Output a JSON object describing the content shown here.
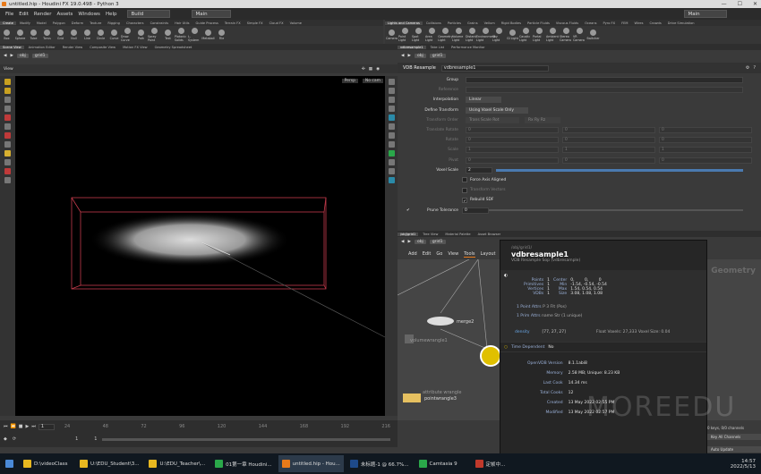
{
  "window": {
    "title": "untitled.hip - Houdini FX 19.0.498 - Python 3"
  },
  "menubar": {
    "items": [
      "File",
      "Edit",
      "Render",
      "Assets",
      "Windows",
      "Help"
    ],
    "build": "Build",
    "desktop": "Main",
    "desktop2": "Main"
  },
  "shelf_left": {
    "tabs": [
      "Create",
      "Modify",
      "Model",
      "Polygon",
      "Deform",
      "Texture",
      "Rigging",
      "Characters",
      "Constraints",
      "Hair Utils",
      "Guide Process",
      "Terrain FX",
      "Simple FX",
      "Cloud FX",
      "Volume"
    ],
    "tools": [
      "Box",
      "Sphere",
      "Tube",
      "Torus",
      "Grid",
      "Null",
      "Line",
      "Circle",
      "Curve",
      "Draw Curve",
      "Path",
      "Spray Paint",
      "Text",
      "Platonic Solids",
      "L-System",
      "Metaball",
      "File"
    ]
  },
  "shelf_right": {
    "tabs": [
      "Lights and Cameras",
      "Collisions",
      "Particles",
      "Grains",
      "Vellum",
      "Rigid Bodies",
      "Particle Fluids",
      "Viscous Fluids",
      "Oceans",
      "Pyro FX",
      "FEM",
      "Wires",
      "Crowds",
      "Drive Simulation"
    ],
    "tools": [
      "Camera",
      "Point Light",
      "Spot Light",
      "Area Light",
      "Geometry Light",
      "Volume Light",
      "Distant Light",
      "Environment Light",
      "Sky Light",
      "GI Light",
      "Caustic Light",
      "Portal Light",
      "Ambient Light",
      "Stereo Camera",
      "VR Camera",
      "Switcher"
    ]
  },
  "left_pane": {
    "tabs": [
      "Scene View",
      "Animation Editor",
      "Render View",
      "Composite View",
      "Motion FX View",
      "Geometry Spreadsheet"
    ],
    "viewer_label": "View",
    "path": [
      "obj",
      "grid1"
    ],
    "persp": "Persp",
    "cam": "No cam"
  },
  "right_pane": {
    "tabs": [
      "vdbresample1",
      "Take List",
      "Performance Monitor"
    ],
    "path": [
      "obj",
      "grid1"
    ]
  },
  "parameters": {
    "node_type": "VDB Resample",
    "node_name": "vdbresample1",
    "rows": [
      {
        "label": "Group",
        "value": "",
        "dim": false
      },
      {
        "label": "Reference",
        "value": "",
        "dim": true
      },
      {
        "label": "Interpolation",
        "value": "Linear",
        "dim": false
      },
      {
        "label": "Define Transform",
        "value": "Using Voxel Scale Only",
        "dim": false
      },
      {
        "label": "Transform Order",
        "value": "Trans Scale Rot",
        "dim": true,
        "value2": "Rx Ry Rz"
      },
      {
        "label": "Translate Rotate",
        "value": "0",
        "dim": true
      },
      {
        "label": "Rotate",
        "value": "0",
        "dim": true
      },
      {
        "label": "Scale",
        "value": "1",
        "dim": true
      },
      {
        "label": "Pivot",
        "value": "0",
        "dim": true
      },
      {
        "label": "Voxel Scale",
        "value": "2",
        "dim": false
      }
    ],
    "checks": [
      "Force Axis Aligned",
      "Transform Vectors",
      "Rebuild SDF"
    ],
    "prune_label": "Prune Tolerance",
    "prune_value": "0"
  },
  "network": {
    "tabs": [
      "/obj/grid1",
      "Tree View",
      "Material Palette",
      "Asset Browser"
    ],
    "path": [
      "obj",
      "grid1"
    ],
    "menu": [
      "Add",
      "Edit",
      "Go",
      "View",
      "Tools",
      "Layout"
    ],
    "context_label": "Geometry",
    "nodes": [
      "merge2",
      "volumewrangle1",
      "attribute wrangle",
      "pointwrangle3"
    ]
  },
  "info": {
    "path": "/obj/grid1/",
    "title": "vdbresample1",
    "subtitle": "VDB Resample Sop (vdbresample)",
    "counts": [
      {
        "k": "Points",
        "v": "1"
      },
      {
        "k": "Primitives",
        "v": "1"
      },
      {
        "k": "Vertices",
        "v": "1"
      },
      {
        "k": "VDBs",
        "v": "1"
      }
    ],
    "bounds_header": [
      "Center",
      "0,",
      "0,",
      "0"
    ],
    "bounds": [
      {
        "k": "Min",
        "v": "-1.54,  -0.54,  -0.54"
      },
      {
        "k": "Max",
        "v": "1.54,   0.54,   0.54"
      },
      {
        "k": "Size",
        "v": "3.08,   1.08,   1.08"
      }
    ],
    "attrs": [
      {
        "k": "1 Point Attrs",
        "v": "P  3 Flt (Pos)"
      },
      {
        "k": "1 Prim Attrs",
        "v": "name  Str (1 unique)"
      }
    ],
    "volume": {
      "name": "density",
      "res": "[77, 27, 27]",
      "voxels": "Float Voxels: 27,333 Voxel Size: 0.04"
    },
    "time_dependent": {
      "k": "Time Dependent",
      "v": "No"
    },
    "stats": [
      {
        "k": "OpenVDB Version",
        "v": "8.1.1abi8"
      },
      {
        "k": "Memory",
        "v": "2.58 MB; Unique: 8.23 KB"
      },
      {
        "k": "Last Cook",
        "v": "14.34 ms"
      },
      {
        "k": "Total Cooks",
        "v": "12"
      },
      {
        "k": "Created",
        "v": "13 May 2022 02:55 PM"
      },
      {
        "k": "Modified",
        "v": "13 May 2022 02:57 PM"
      }
    ]
  },
  "timeline": {
    "frame": "1",
    "ticks": [
      "24",
      "48",
      "72",
      "96",
      "120",
      "144",
      "168",
      "192",
      "216"
    ],
    "start": "1",
    "end": "1",
    "keys_text": "0 keys, 0/0 channels",
    "all_channels": "Key All Channels",
    "auto_update": "Auto Update"
  },
  "taskbar": {
    "items": [
      {
        "label": "D:\\videoClass",
        "color": "#e8b820"
      },
      {
        "label": "U:\\EDU_Student\\3...",
        "color": "#e8b820"
      },
      {
        "label": "U:\\EDU_Teacher\\...",
        "color": "#e8b820"
      },
      {
        "label": "01第一章 Houdini...",
        "color": "#2aa84a"
      },
      {
        "label": "untitled.hip - Hou...",
        "color": "#e87a1a"
      },
      {
        "label": "未标题-1 @ 66.7%...",
        "color": "#1e4a8a"
      },
      {
        "label": "Camtasia 9",
        "color": "#2aa84a"
      },
      {
        "label": "定帧中...",
        "color": "#c0392b"
      }
    ],
    "time": "14:57",
    "date": "2022/5/13"
  },
  "watermark": "MOREEDU",
  "colors": {
    "accent": "#e87a1a",
    "bbox": "#c23a4a",
    "selected": "#e0c000",
    "popup_bg": "#262626"
  }
}
